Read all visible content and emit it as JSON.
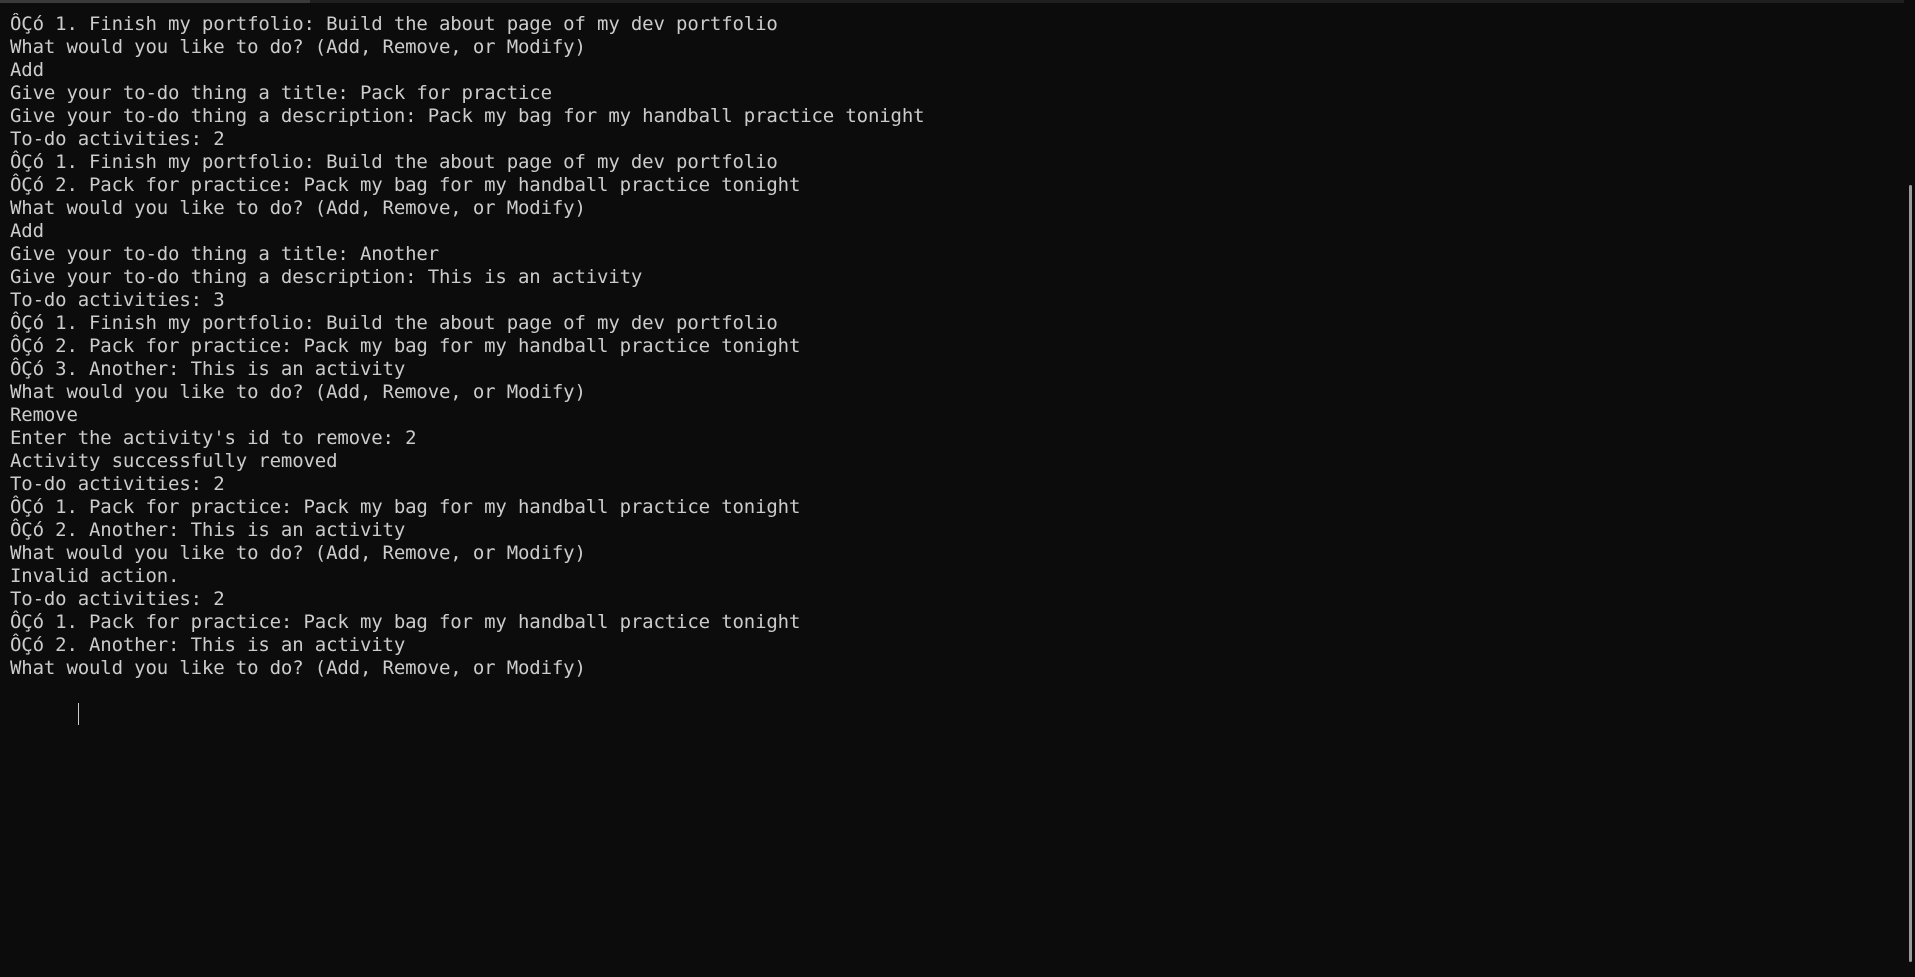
{
  "terminal": {
    "lines": [
      "ÔÇó 1. Finish my portfolio: Build the about page of my dev portfolio",
      "What would you like to do? (Add, Remove, or Modify)",
      "Add",
      "Give your to-do thing a title: Pack for practice",
      "Give your to-do thing a description: Pack my bag for my handball practice tonight",
      "To-do activities: 2",
      "ÔÇó 1. Finish my portfolio: Build the about page of my dev portfolio",
      "ÔÇó 2. Pack for practice: Pack my bag for my handball practice tonight",
      "What would you like to do? (Add, Remove, or Modify)",
      "Add",
      "Give your to-do thing a title: Another",
      "Give your to-do thing a description: This is an activity",
      "To-do activities: 3",
      "ÔÇó 1. Finish my portfolio: Build the about page of my dev portfolio",
      "ÔÇó 2. Pack for practice: Pack my bag for my handball practice tonight",
      "ÔÇó 3. Another: This is an activity",
      "What would you like to do? (Add, Remove, or Modify)",
      "Remove",
      "Enter the activity's id to remove: 2",
      "Activity successfully removed",
      "To-do activities: 2",
      "ÔÇó 1. Pack for practice: Pack my bag for my handball practice tonight",
      "ÔÇó 2. Another: This is an activity",
      "What would you like to do? (Add, Remove, or Modify)",
      "Invalid action.",
      "To-do activities: 2",
      "ÔÇó 1. Pack for practice: Pack my bag for my handball practice tonight",
      "ÔÇó 2. Another: This is an activity",
      "What would you like to do? (Add, Remove, or Modify)"
    ]
  },
  "colors": {
    "background": "#0c0c0c",
    "text": "#cccccc",
    "scrollbar_thumb": "#9a9a9a"
  }
}
